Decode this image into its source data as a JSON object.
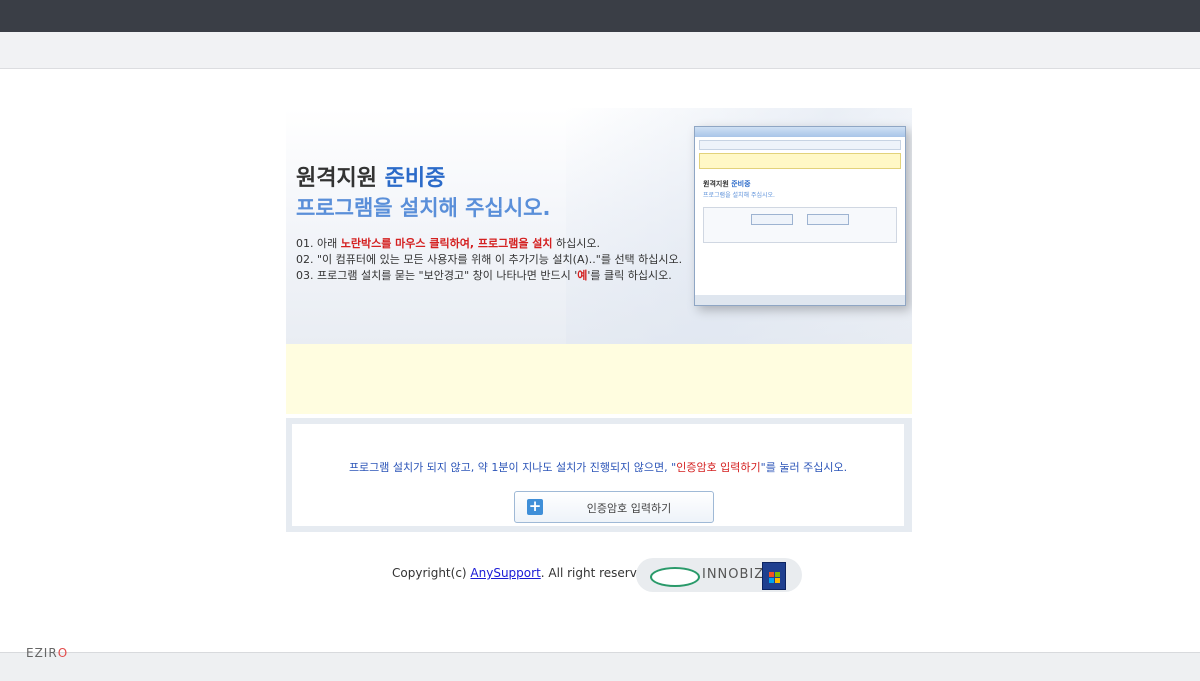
{
  "hero": {
    "title_main": "원격지원",
    "title_accent": "준비중",
    "subtitle": "프로그램을 설치해 주십시오.",
    "step1_prefix": "01. 아래 ",
    "step1_red": "노란박스를 마우스 클릭하여, 프로그램을 설치",
    "step1_suffix": " 하십시오.",
    "step2": "02. \"이 컴퓨터에 있는 모든 사용자를 위해 이 추가기능 설치(A)..\"를 선택 하십시오.",
    "step3_prefix": "03. 프로그램 설치를 묻는 \"보안경고\" 창이 나타나면 반드시 '",
    "step3_red": "예",
    "step3_suffix": "'를 클릭 하십시오."
  },
  "preview": {
    "title_main": "원격지원",
    "title_accent": "준비중",
    "subtitle": "프로그램을 설치해 주십시오."
  },
  "panel": {
    "notice_prefix": "프로그램 설치가 되지 않고, 약 1분이 지나도 설치가 진행되지 않으면, \"",
    "notice_red": "인증암호 입력하기",
    "notice_suffix": "\"를 눌러 주십시오.",
    "auth_button_label": "인증암호 입력하기"
  },
  "footer": {
    "copyright_prefix": "Copyright(c) ",
    "company_link": "AnySupport",
    "copyright_suffix": ". All right reserved.",
    "badge_text": "INNOBIZ"
  },
  "brand": {
    "eziro_prefix": "EZIR",
    "eziro_suffix": "O"
  },
  "icons": {
    "auth_button_icon": "plus-icon"
  },
  "colors": {
    "accent_blue": "#2c6bc9",
    "alert_red": "#d42020",
    "top_bar": "#3a3e46"
  }
}
